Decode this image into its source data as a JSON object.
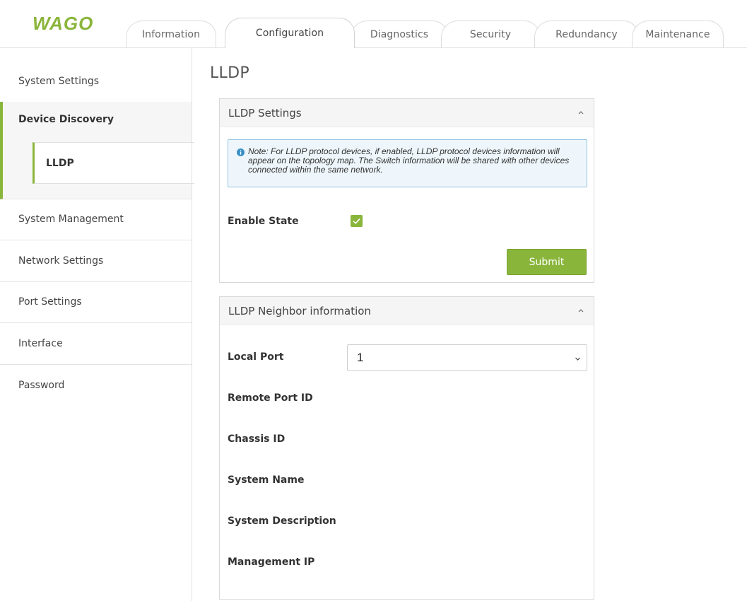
{
  "brand": {
    "logo_text": "WAGO",
    "accent_color": "#8ab53b"
  },
  "tabs": [
    {
      "label": "Information",
      "active": false
    },
    {
      "label": "Configuration",
      "active": true
    },
    {
      "label": "Diagnostics",
      "active": false
    },
    {
      "label": "Security",
      "active": false
    },
    {
      "label": "Redundancy",
      "active": false
    },
    {
      "label": "Maintenance",
      "active": false
    }
  ],
  "sidebar": {
    "items": [
      {
        "label": "System Settings"
      },
      {
        "label": "Device Discovery",
        "expanded": true,
        "children": [
          {
            "label": "LLDP",
            "active": true
          }
        ]
      },
      {
        "label": "System Management"
      },
      {
        "label": "Network Settings"
      },
      {
        "label": "Port Settings"
      },
      {
        "label": "Interface"
      },
      {
        "label": "Password"
      }
    ]
  },
  "main": {
    "title": "LLDP",
    "settings_panel": {
      "title": "LLDP Settings",
      "collapse_icon": "chevron-up-icon",
      "note_icon": "info-icon",
      "note": "Note: For LLDP protocol devices, if enabled, LLDP protocol devices information will appear on the topology map. The Switch information will be shared with other devices connected within the same network.",
      "enable_state_label": "Enable State",
      "enable_state_checked": true,
      "submit_label": "Submit"
    },
    "neighbor_panel": {
      "title": "LLDP Neighbor information",
      "collapse_icon": "chevron-up-icon",
      "local_port_label": "Local Port",
      "local_port_value": "1",
      "fields": [
        {
          "label": "Remote Port ID",
          "value": ""
        },
        {
          "label": "Chassis ID",
          "value": ""
        },
        {
          "label": "System Name",
          "value": ""
        },
        {
          "label": "System Description",
          "value": ""
        },
        {
          "label": "Management IP",
          "value": ""
        }
      ]
    }
  }
}
